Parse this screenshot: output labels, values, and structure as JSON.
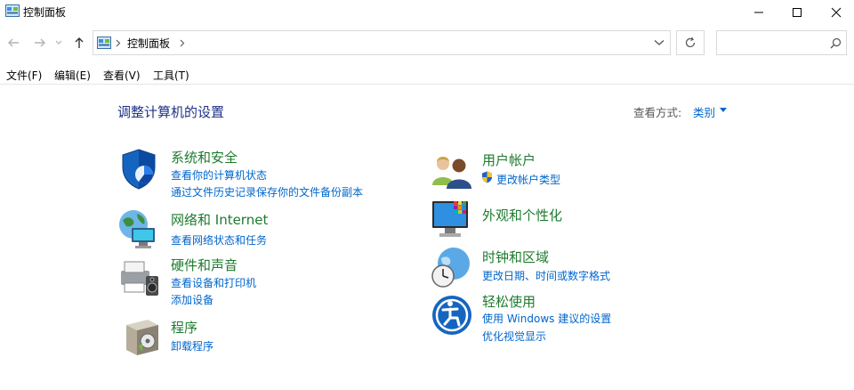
{
  "window": {
    "title": "控制面板"
  },
  "address": {
    "path": "控制面板"
  },
  "menu": [
    "文件(F)",
    "编辑(E)",
    "查看(V)",
    "工具(T)"
  ],
  "heading": "调整计算机的设置",
  "view": {
    "label": "查看方式:",
    "value": "类别"
  },
  "categories": {
    "system": {
      "title": "系统和安全",
      "links": [
        "查看你的计算机状态",
        "通过文件历史记录保存你的文件备份副本"
      ]
    },
    "network": {
      "title": "网络和 Internet",
      "links": [
        "查看网络状态和任务"
      ]
    },
    "hardware": {
      "title": "硬件和声音",
      "links": [
        "查看设备和打印机",
        "添加设备"
      ]
    },
    "programs": {
      "title": "程序",
      "links": [
        "卸载程序"
      ]
    },
    "users": {
      "title": "用户帐户",
      "links": [
        "更改帐户类型"
      ]
    },
    "appearance": {
      "title": "外观和个性化",
      "links": []
    },
    "clock": {
      "title": "时钟和区域",
      "links": [
        "更改日期、时间或数字格式"
      ]
    },
    "ease": {
      "title": "轻松使用",
      "links": [
        "使用 Windows 建议的设置",
        "优化视觉显示"
      ]
    }
  },
  "colors": {
    "link": "#0066cc",
    "category": "#1e7b2e",
    "heading": "#1e3287"
  }
}
